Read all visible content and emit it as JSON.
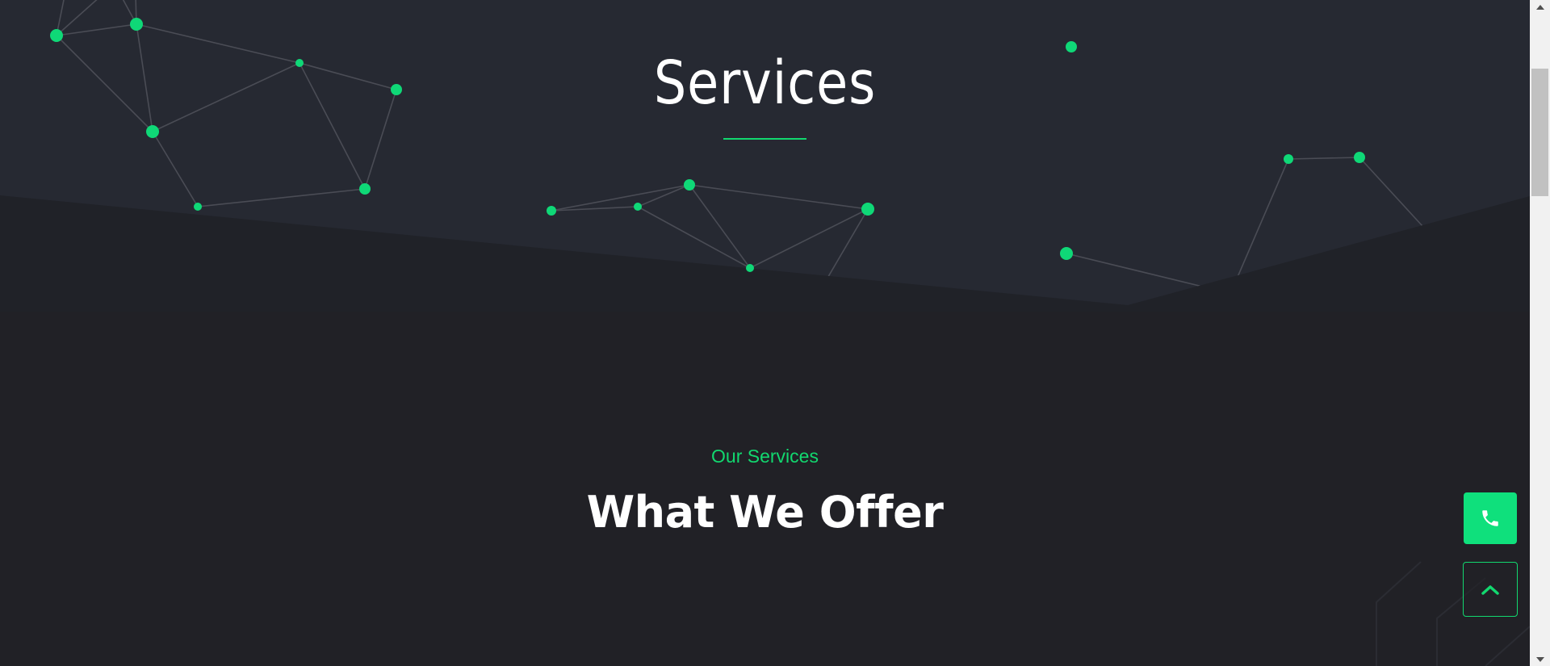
{
  "hero": {
    "title": "Services"
  },
  "services_section": {
    "eyebrow": "Our Services",
    "heading": "What We Offer"
  },
  "floating_actions": {
    "call_icon": "phone-icon",
    "scroll_top_icon": "chevron-up-icon"
  },
  "colors": {
    "accent": "#12d86f",
    "hero_bg": "#262932",
    "page_bg": "#212126",
    "text": "#ffffff",
    "network_line": "#4a4c55"
  },
  "scrollbar": {
    "up_icon": "triangle-up-icon",
    "down_icon": "triangle-down-icon"
  }
}
